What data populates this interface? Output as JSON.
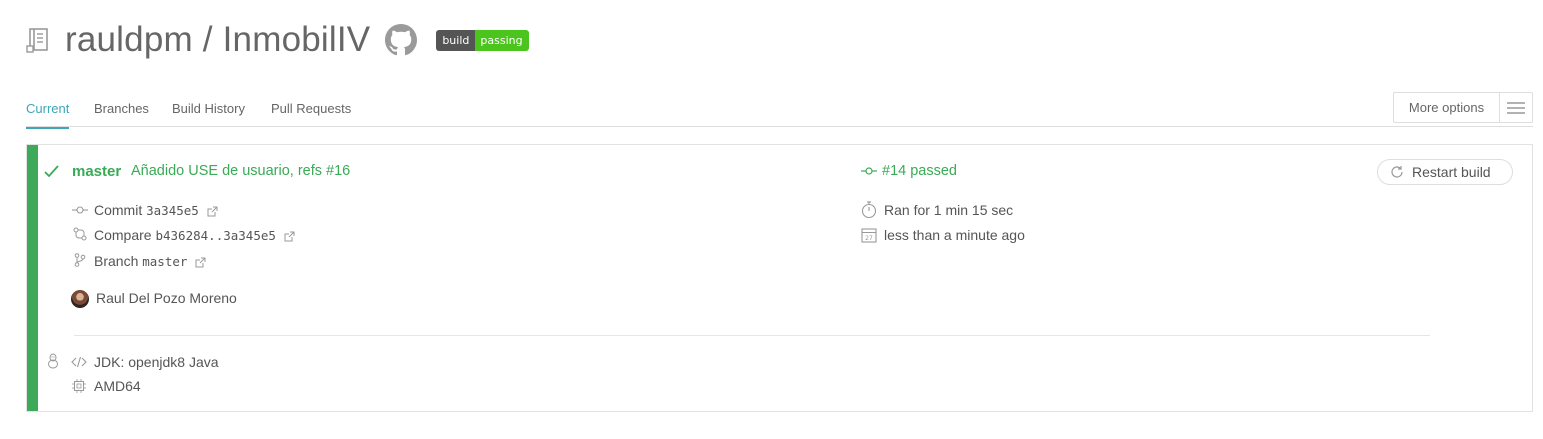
{
  "header": {
    "repo_title": "rauldpm / InmobilIV",
    "badge_left": "build",
    "badge_right": "passing"
  },
  "tabs": [
    {
      "label": "Current",
      "active": true
    },
    {
      "label": "Branches"
    },
    {
      "label": "Build History"
    },
    {
      "label": "Pull Requests"
    }
  ],
  "more_options": "More options",
  "build": {
    "status": "passed",
    "branch": "master",
    "commit_message": "Añadido USE de usuario, refs #16",
    "number_text": "#14 passed",
    "restart_label": "Restart build",
    "commit_label": "Commit",
    "commit_sha": "3a345e5",
    "compare_label": "Compare",
    "compare_range": "b436284..3a345e5",
    "branch_label": "Branch",
    "branch_name": "master",
    "duration": "Ran for 1 min 15 sec",
    "finished": "less than a minute ago",
    "author": "Raul Del Pozo Moreno",
    "jdk": "JDK: openjdk8 Java",
    "arch": "AMD64"
  },
  "colors": {
    "passed_green": "#39aa56",
    "tab_active": "#3ea7b5",
    "badge_passing": "#4bc51d",
    "badge_label": "#555555"
  },
  "icons": [
    "repo-icon",
    "github-icon",
    "hamburger-icon",
    "check-icon",
    "commit-icon",
    "compare-icon",
    "branch-icon",
    "external-link-icon",
    "stopwatch-icon",
    "calendar-icon",
    "restart-icon",
    "linux-icon",
    "code-icon",
    "cpu-icon"
  ]
}
